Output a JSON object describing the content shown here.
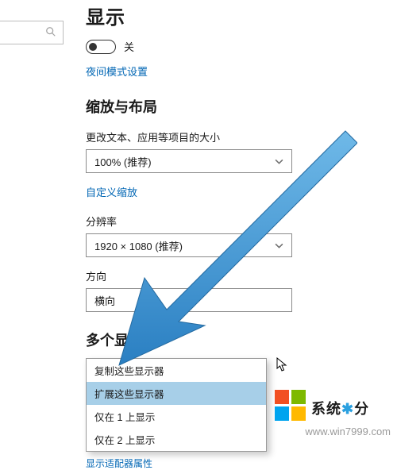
{
  "page": {
    "title": "显示",
    "toggle": {
      "state": "off",
      "label": "关"
    },
    "links": {
      "night_mode": "夜间模式设置",
      "custom_scaling": "自定义缩放",
      "adapter_props": "显示适配器属性"
    }
  },
  "scale_layout": {
    "heading": "缩放与布局",
    "text_size": {
      "label": "更改文本、应用等项目的大小",
      "value": "100% (推荐)"
    },
    "resolution": {
      "label": "分辨率",
      "value": "1920 × 1080 (推荐)"
    },
    "orientation": {
      "label": "方向",
      "value": "横向"
    }
  },
  "multi_display": {
    "heading": "多个显示器",
    "options": [
      "复制这些显示器",
      "扩展这些显示器",
      "仅在 1 上显示",
      "仅在 2 上显示"
    ],
    "selected_index": 1
  },
  "footer": {
    "brand_a": "系统",
    "brand_b": "分",
    "url": "www.win7999.com"
  }
}
